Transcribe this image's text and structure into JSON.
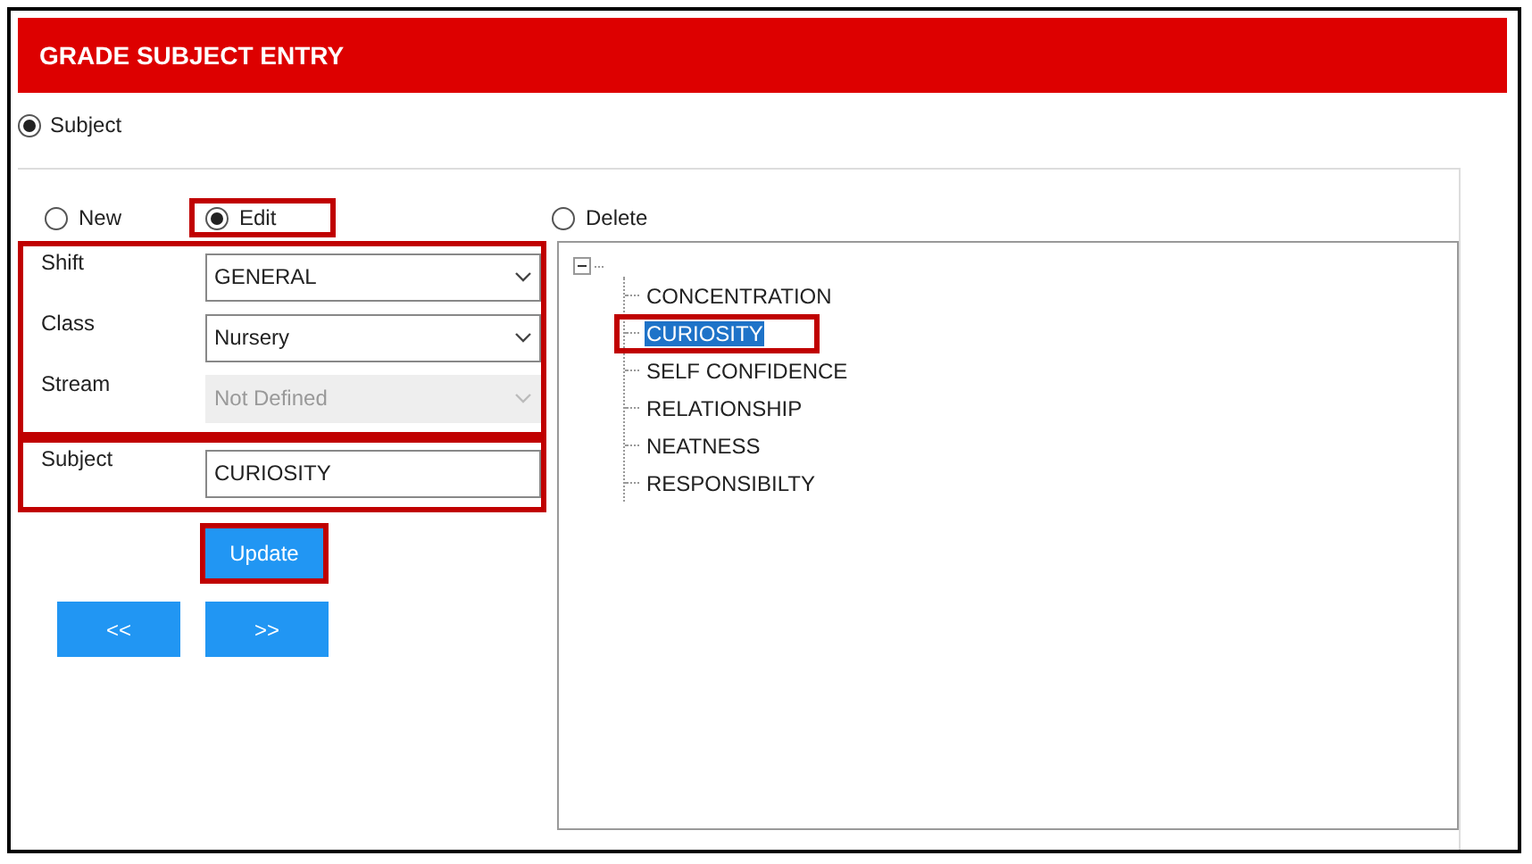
{
  "window": {
    "title": "GRADE SUBJECT ENTRY"
  },
  "entry_type": {
    "label": "Subject",
    "selected": true
  },
  "modes": [
    {
      "label": "New",
      "selected": false,
      "highlighted": false
    },
    {
      "label": "Edit",
      "selected": true,
      "highlighted": true
    },
    {
      "label": "Delete",
      "selected": false,
      "highlighted": false
    }
  ],
  "form_groups": [
    {
      "highlighted": true,
      "fields": [
        {
          "label": "Shift",
          "kind": "dropdown",
          "value": "GENERAL",
          "disabled": false
        },
        {
          "label": "Class",
          "kind": "dropdown",
          "value": "Nursery",
          "disabled": false
        },
        {
          "label": "Stream",
          "kind": "dropdown",
          "value": "Not Defined",
          "disabled": true
        }
      ]
    },
    {
      "highlighted": true,
      "fields": [
        {
          "label": "Subject",
          "kind": "text",
          "value": "CURIOSITY"
        }
      ]
    }
  ],
  "update_button": {
    "label": "Update",
    "highlighted": true
  },
  "nav_buttons": [
    "<<",
    ">>"
  ],
  "tree": {
    "expanded": true,
    "children": [
      {
        "label": "CONCENTRATION",
        "selected": false,
        "highlighted": false
      },
      {
        "label": "CURIOSITY",
        "selected": true,
        "highlighted": true
      },
      {
        "label": "SELF CONFIDENCE",
        "selected": false,
        "highlighted": false
      },
      {
        "label": "RELATIONSHIP",
        "selected": false,
        "highlighted": false
      },
      {
        "label": "NEATNESS",
        "selected": false,
        "highlighted": false
      },
      {
        "label": "RESPONSIBILTY",
        "selected": false,
        "highlighted": false
      }
    ]
  }
}
